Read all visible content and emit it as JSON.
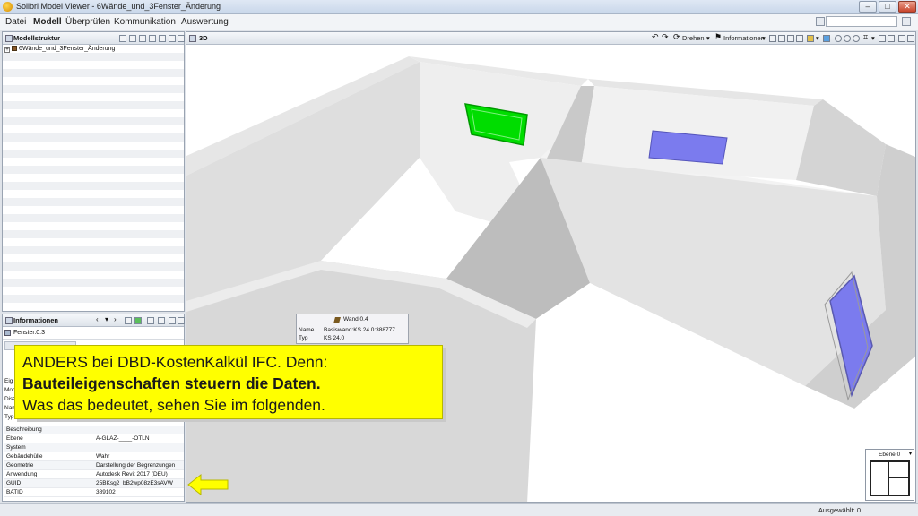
{
  "window": {
    "title": "Solibri Model Viewer - 6Wände_und_3Fenster_Änderung"
  },
  "menu": {
    "items": [
      "Datei",
      "Modell",
      "Überprüfen",
      "Kommunikation",
      "Auswertung"
    ],
    "active": "Modell"
  },
  "model_tree": {
    "title": "Modellstruktur",
    "root": "6Wände_und_3Fenster_Änderung"
  },
  "info_panel": {
    "title": "Informationen",
    "selected": "Fenster.0.3",
    "partial_labels": [
      "Eig",
      "Mod",
      "Disz",
      "Nam",
      "Typ"
    ],
    "properties": [
      {
        "key": "Beschreibung",
        "value": ""
      },
      {
        "key": "Ebene",
        "value": "A-GLAZ-____-OTLN"
      },
      {
        "key": "System",
        "value": ""
      },
      {
        "key": "Gebäudehülle",
        "value": "Wahr"
      },
      {
        "key": "Geometrie",
        "value": "Darstellung der Begrenzungen"
      },
      {
        "key": "Anwendung",
        "value": "Autodesk Revit 2017 (DEU)"
      },
      {
        "key": "GUID",
        "value": "25BKsg2_bB2wp08zE3sAVW"
      },
      {
        "key": "BATID",
        "value": "389102"
      }
    ]
  },
  "viewport": {
    "title": "3D",
    "toolbar": {
      "rotate": "Drehen",
      "info": "Informationen"
    },
    "minimap_label": "Ebene 0"
  },
  "tooltip": {
    "title": "Wand.0.4",
    "rows": [
      {
        "key": "Name",
        "value": "Basiswand:KS 24.0:388777"
      },
      {
        "key": "Typ",
        "value": "KS 24.0"
      }
    ]
  },
  "callout": {
    "line1": "ANDERS bei DBD-KostenKalkül IFC. Denn:",
    "line2": "Bauteileigenschaften steuern die Daten.",
    "line3": "Was das bedeutet, sehen Sie im folgenden."
  },
  "status": {
    "text": "Ausgewählt: 0"
  },
  "colors": {
    "callout_bg": "#ffff00",
    "arrow": "#ffff00",
    "selected_window": "#00e000",
    "window_glass": "#7777ee",
    "wall_top": "#f0f0f0",
    "wall_side": "#c8c8c8",
    "floor": "#ffffff"
  },
  "icons": [
    "app-icon",
    "minimize-icon",
    "maximize-icon",
    "close-icon",
    "rotate-icon",
    "info-icon",
    "zoom-icon",
    "arrow-icon"
  ]
}
